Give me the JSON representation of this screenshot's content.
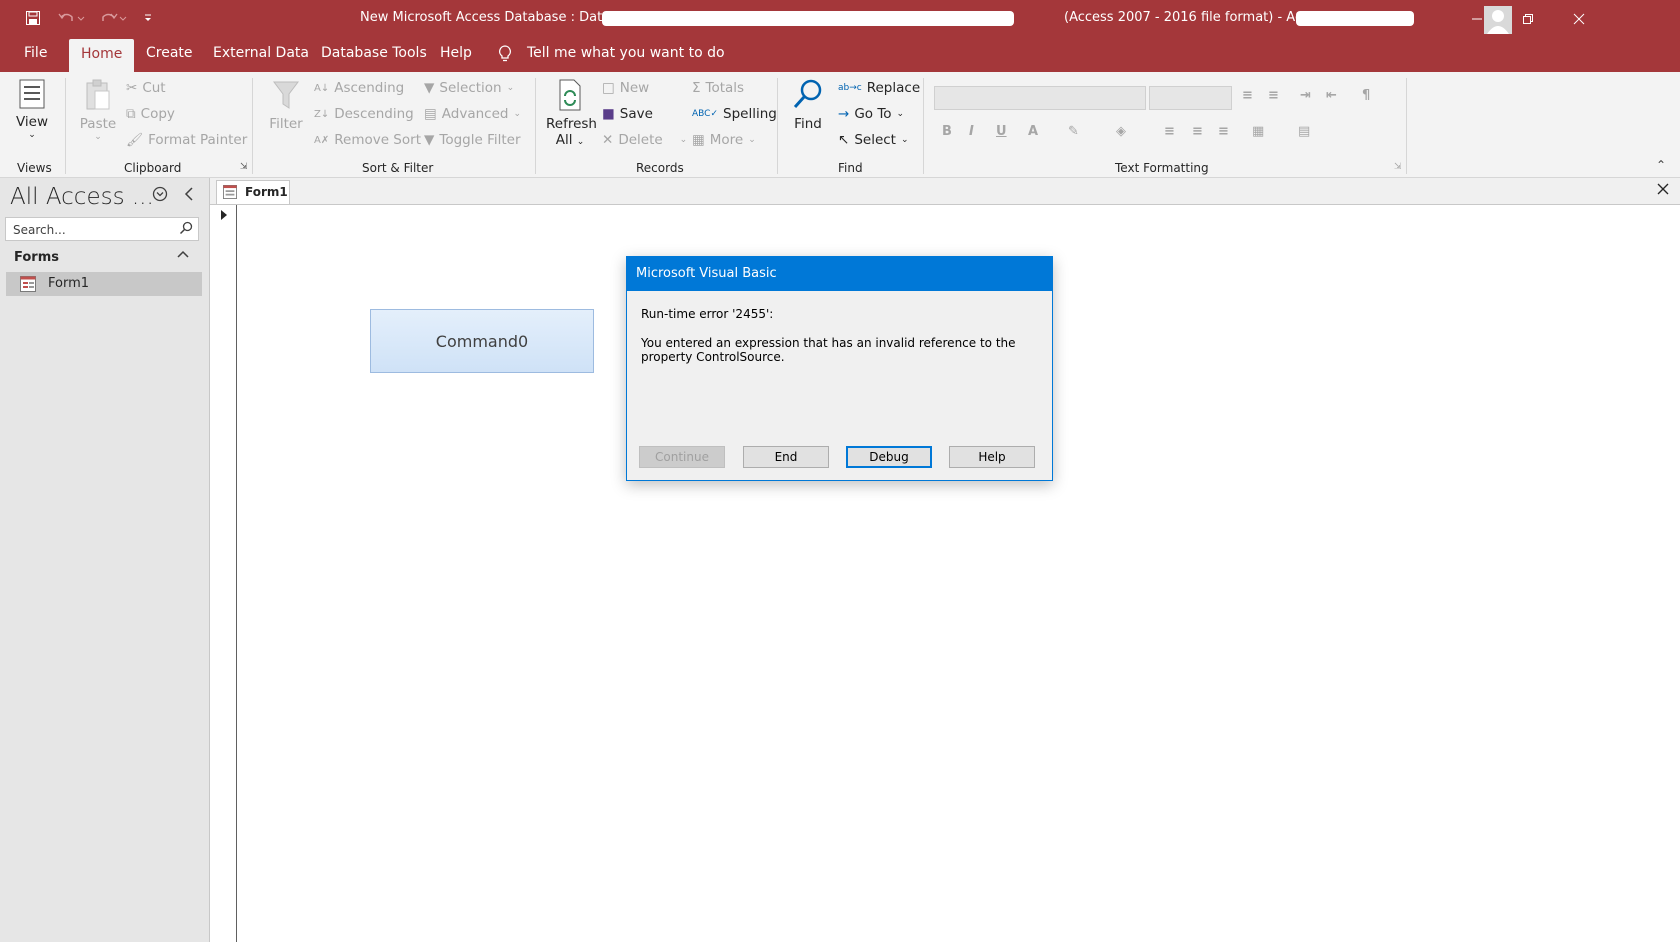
{
  "colors": {
    "access_red": "#a4373a",
    "ribbon_bg": "#f3f3f3",
    "dialog_blue": "#0078d7"
  },
  "window": {
    "title_prefix": "New Microsoft Access Database : Database-",
    "title_suffix": "(Access 2007 - 2016 file format)  -  Access"
  },
  "menu": {
    "file": "File",
    "home": "Home",
    "create": "Create",
    "external_data": "External Data",
    "database_tools": "Database Tools",
    "help": "Help",
    "tell_me": "Tell me what you want to do"
  },
  "ribbon": {
    "views": {
      "view": "View",
      "label": "Views"
    },
    "clipboard": {
      "paste": "Paste",
      "cut": "Cut",
      "copy": "Copy",
      "format_painter": "Format Painter",
      "label": "Clipboard"
    },
    "sort_filter": {
      "filter": "Filter",
      "ascending": "Ascending",
      "descending": "Descending",
      "remove_sort": "Remove Sort",
      "selection": "Selection",
      "advanced": "Advanced",
      "toggle_filter": "Toggle Filter",
      "label": "Sort & Filter"
    },
    "records": {
      "refresh": "Refresh",
      "refresh_all": "All",
      "new": "New",
      "save": "Save",
      "delete": "Delete",
      "totals": "Totals",
      "spelling": "Spelling",
      "more": "More",
      "label": "Records"
    },
    "find": {
      "find": "Find",
      "replace": "Replace",
      "goto": "Go To",
      "select": "Select",
      "label": "Find"
    },
    "text_formatting": {
      "bold": "B",
      "italic": "I",
      "underline": "U",
      "font_color": "A",
      "label": "Text Formatting"
    }
  },
  "nav": {
    "title": "All Access ...",
    "search_placeholder": "Search...",
    "category": "Forms",
    "items": [
      {
        "label": "Form1"
      }
    ]
  },
  "document": {
    "tab": "Form1",
    "command_button": "Command0"
  },
  "dialog": {
    "title": "Microsoft Visual Basic",
    "error_line": "Run-time error '2455':",
    "message": "You entered an expression that has an invalid reference to the property ControlSource.",
    "buttons": {
      "continue": "Continue",
      "end": "End",
      "debug": "Debug",
      "help": "Help"
    }
  }
}
